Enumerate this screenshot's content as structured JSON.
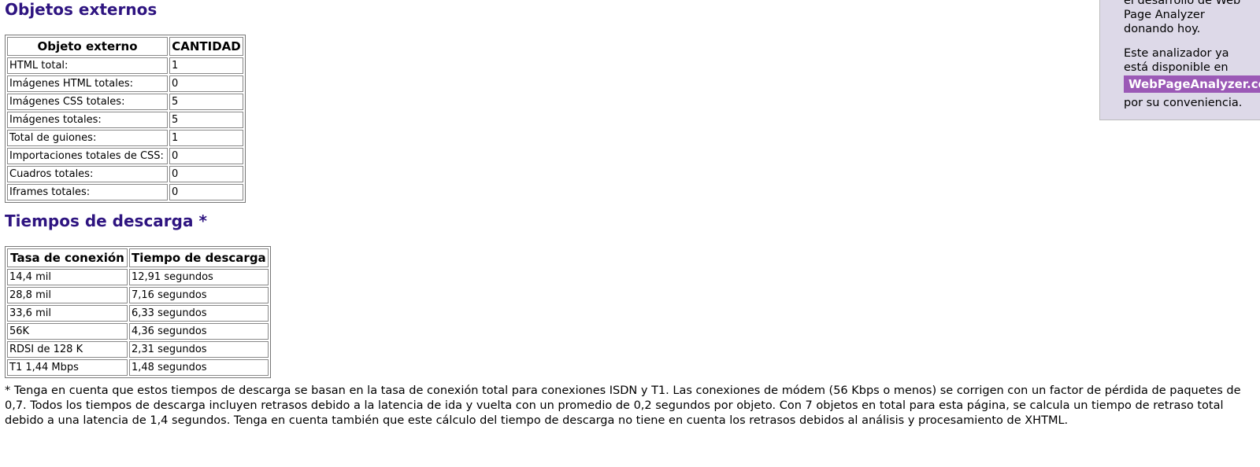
{
  "objetos": {
    "heading": "Objetos externos",
    "headers": [
      "Objeto externo",
      "CANTIDAD"
    ],
    "rows": [
      {
        "label": "HTML total:",
        "value": "1"
      },
      {
        "label": "Imágenes HTML totales:",
        "value": "0"
      },
      {
        "label": "Imágenes CSS totales:",
        "value": "5"
      },
      {
        "label": "Imágenes totales:",
        "value": "5"
      },
      {
        "label": "Total de guiones:",
        "value": "1"
      },
      {
        "label": "Importaciones totales de CSS:",
        "value": "0"
      },
      {
        "label": "Cuadros totales:",
        "value": "0"
      },
      {
        "label": "Iframes totales:",
        "value": "0"
      }
    ]
  },
  "tiempos": {
    "heading": "Tiempos de descarga *",
    "headers": [
      "Tasa de conexión",
      "Tiempo de descarga"
    ],
    "rows": [
      {
        "rate": "14,4 mil",
        "time": "12,91 segundos"
      },
      {
        "rate": "28,8 mil",
        "time": "7,16 segundos"
      },
      {
        "rate": "33,6 mil",
        "time": "6,33 segundos"
      },
      {
        "rate": "56K",
        "time": "4,36 segundos"
      },
      {
        "rate": "RDSI de 128 K",
        "time": "2,31 segundos"
      },
      {
        "rate": "T1 1,44 Mbps",
        "time": "1,48 segundos"
      }
    ]
  },
  "note": "* Tenga en cuenta que estos tiempos de descarga se basan en la tasa de conexión total para conexiones ISDN y T1. Las conexiones de módem (56 Kbps o menos) se corrigen con un factor de pérdida de paquetes de 0,7. Todos los tiempos de descarga incluyen retrasos debido a la latencia de ida y vuelta con un promedio de 0,2 segundos por objeto. Con 7 objetos en total para esta página, se calcula un tiempo de retraso total debido a una latencia de 1,4 segundos. Tenga en cuenta también que este cálculo del tiempo de descarga no tiene en cuenta los retrasos debidos al análisis y procesamiento de XHTML.",
  "sidebar": {
    "line1": "el desarrollo de Web",
    "line2": "Page Analyzer",
    "line3": "donando hoy.",
    "line4": "Este analizador ya",
    "line5": "está disponible en",
    "badge": "WebPageAnalyzer.com",
    "line6": "por su conveniencia."
  },
  "colors": {
    "heading": "#2e1480",
    "sidebar_bg": "#ddd9e8",
    "badge_bg": "#9b59b6"
  }
}
